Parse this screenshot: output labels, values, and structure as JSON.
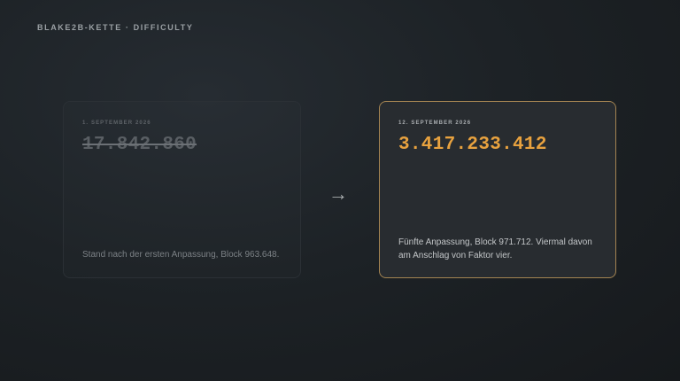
{
  "header": {
    "eyebrow": "BLAKE2B-KETTE · DIFFICULTY"
  },
  "comparison": {
    "before": {
      "date": "1. SEPTEMBER 2026",
      "value": "17.842.860",
      "note": "Stand nach der ersten Anpassung, Block 963.648."
    },
    "after": {
      "date": "12. SEPTEMBER 2026",
      "value": "3.417.233.412",
      "note": "Fünfte Anpassung, Block 971.712. Viermal davon am Anschlag von Faktor vier."
    },
    "arrow_icon": "right-arrow-icon"
  },
  "colors": {
    "accent": "#e8a23f",
    "accent_border": "#a48452"
  }
}
